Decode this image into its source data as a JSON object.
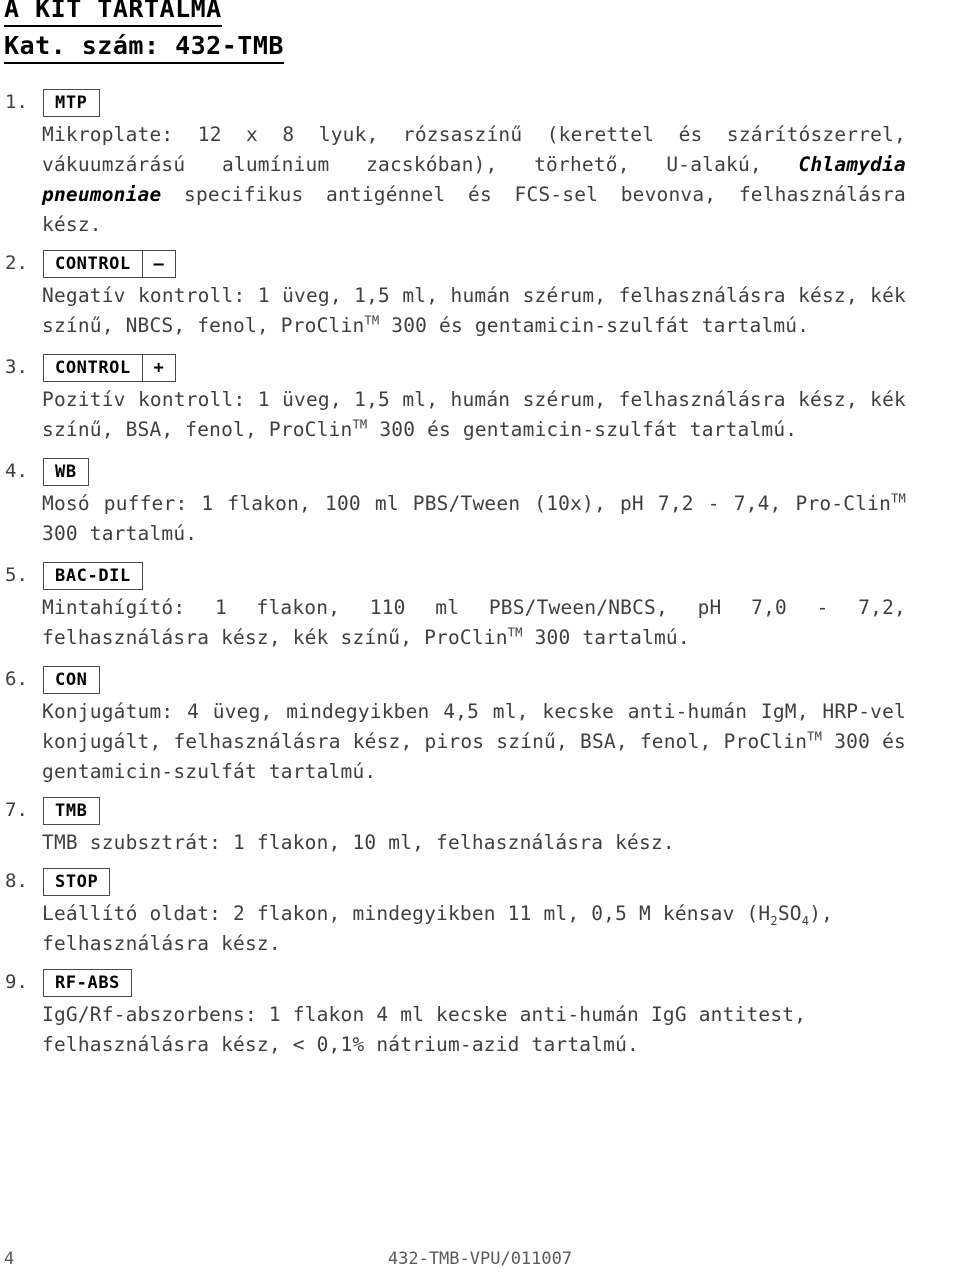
{
  "header": {
    "title": "A KIT TARTALMA",
    "catalog": "Kat. szám: 432-TMB"
  },
  "items": [
    {
      "number": "1.",
      "symbol": "MTP",
      "symbol_suffix": "",
      "body_prefix": "Mikroplate: 12 x 8 lyuk, rózsaszínű (kerettel és szárítószerrel, vákuumzárású alumínium zacskóban), törhető, U-alakú, ",
      "body_italic": "Chlamydia pneumoniae",
      "body_suffix": " specifikus antigénnel és FCS-sel bevonva, felhasználásra kész."
    },
    {
      "number": "2.",
      "symbol": "CONTROL",
      "symbol_suffix": "–",
      "body_a": "Negatív kontroll: 1 üveg, 1,5 ml, humán szérum, felhasználásra kész, kék színű, NBCS, fenol, ProClin",
      "body_tm": "TM",
      "body_b": " 300 és gentamicin-szulfát tartalmú."
    },
    {
      "number": "3.",
      "symbol": "CONTROL",
      "symbol_suffix": "+",
      "body_a": "Pozitív kontroll: 1 üveg, 1,5 ml, humán szérum, felhasználásra kész, kék színű, BSA, fenol, ProClin",
      "body_tm": "TM",
      "body_b": " 300 és gentamicin-szulfát tartalmú."
    },
    {
      "number": "4.",
      "symbol": "WB",
      "symbol_suffix": "",
      "body_a": "Mosó puffer: 1 flakon, 100 ml PBS/Tween (10x), pH 7,2 - 7,4, Pro-Clin",
      "body_tm": "TM",
      "body_b": " 300 tartalmú."
    },
    {
      "number": "5.",
      "symbol": "BAC-DIL",
      "symbol_suffix": "",
      "body_a": "Mintahígító: 1 flakon, 110 ml PBS/Tween/NBCS, pH 7,0 - 7,2, felhasználásra kész, kék színű, ProClin",
      "body_tm": "TM",
      "body_b": " 300 tartalmú."
    },
    {
      "number": "6.",
      "symbol": "CON",
      "symbol_suffix": "",
      "body_a": "Konjugátum: 4 üveg, mindegyikben 4,5 ml, kecske anti-humán IgM, HRP-vel konjugált, felhasználásra kész, piros színű, BSA, fenol, ProClin",
      "body_tm": "TM",
      "body_b": " 300 és gentamicin-szulfát tartalmú."
    },
    {
      "number": "7.",
      "symbol": "TMB",
      "symbol_suffix": "",
      "body_a": "TMB szubsztrát: 1 flakon, 10 ml, felhasználásra kész.",
      "body_tm": "",
      "body_b": ""
    },
    {
      "number": "8.",
      "symbol": "STOP",
      "symbol_suffix": "",
      "body_a": "Leállító oldat: 2 flakon, mindegyikben 11 ml, 0,5 M kénsav (H",
      "sub1": "2",
      "body_mid": "SO",
      "sub2": "4",
      "body_b": "), felhasználásra kész."
    },
    {
      "number": "9.",
      "symbol": "RF-ABS",
      "symbol_suffix": "",
      "body_a": "IgG/Rf-abszorbens: 1 flakon 4 ml kecske anti-humán IgG antitest, felhasználásra kész, < 0,1% nátrium-azid tartalmú.",
      "body_tm": "",
      "body_b": ""
    }
  ],
  "footer": {
    "page_number": "4",
    "doc_code": "432-TMB-VPU/011007"
  }
}
